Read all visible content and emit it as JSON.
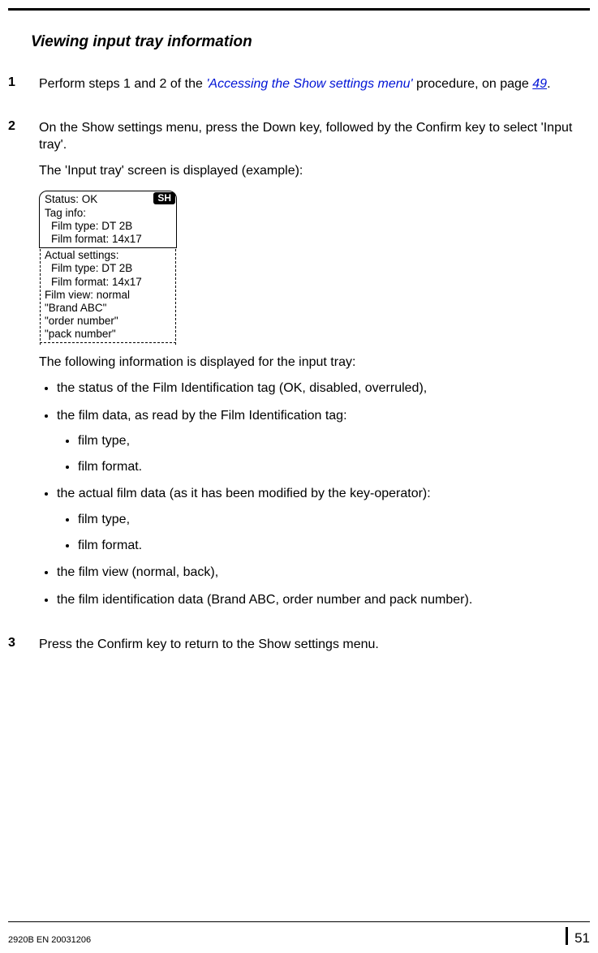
{
  "title": "Viewing input tray information",
  "steps": {
    "one": {
      "num": "1",
      "text_a": "Perform steps 1 and 2 of the ",
      "link": "'Accessing the Show settings menu'",
      "text_b": " procedure, on page ",
      "pagelink": "49",
      "text_c": "."
    },
    "two": {
      "num": "2",
      "p1": "On the Show settings menu, press the Down key, followed by the Confirm key to select 'Input tray'.",
      "p2": "The 'Input tray' screen is displayed (example):",
      "screen": {
        "badge": "SH",
        "boxed": [
          "Status: OK",
          "Tag info:",
          "Film type: DT 2B",
          "Film format: 14x17"
        ],
        "below": [
          "Actual settings:",
          "Film type: DT 2B",
          "Film format: 14x17",
          "Film view: normal",
          "\"Brand ABC\"",
          "\"order number\"",
          "\"pack number\""
        ]
      },
      "p3": "The following information is displayed for the input tray:",
      "bullets": {
        "b1": "the status of the Film Identification tag (OK, disabled, overruled),",
        "b2": "the film data, as read by the Film Identification tag:",
        "b2a": "film type,",
        "b2b": "film format.",
        "b3": "the actual film data (as it has been modified by the key-operator):",
        "b3a": "film type,",
        "b3b": "film format.",
        "b4": "the film view (normal, back),",
        "b5": "the film identification data (Brand ABC, order number and pack number)."
      }
    },
    "three": {
      "num": "3",
      "p1": "Press the Confirm key to return to the Show settings menu."
    }
  },
  "footer": {
    "left": "2920B EN 20031206",
    "right": "51"
  }
}
